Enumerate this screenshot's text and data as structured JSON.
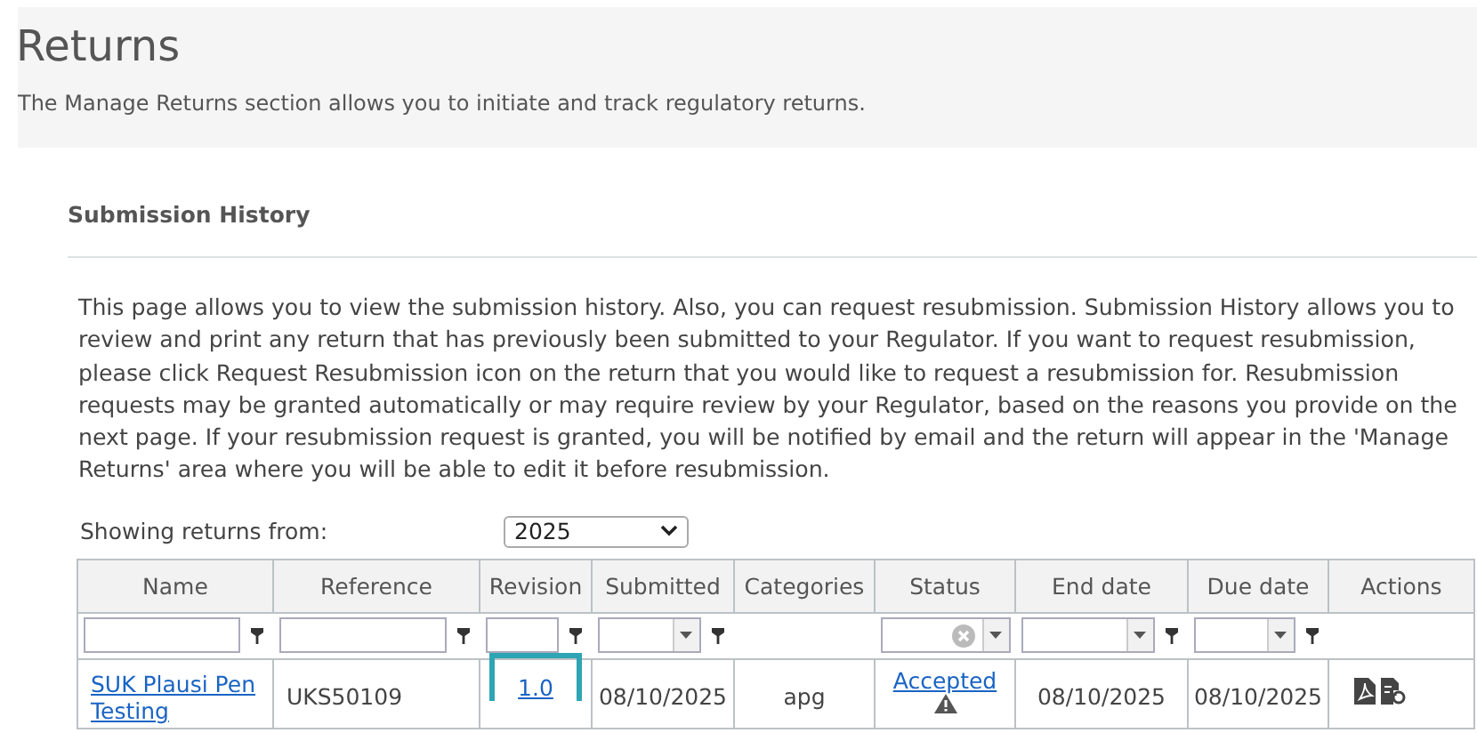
{
  "header": {
    "title": "Returns",
    "subtitle": "The Manage Returns section allows you to initiate and track regulatory returns."
  },
  "section": {
    "title": "Submission History",
    "description": "This page allows you to view the submission history. Also, you can request resubmission. Submission History allows you to review and print any return that has previously been submitted to your Regulator. If you want to request resubmission, please click Request Resubmission icon on the return that you would like to request a resubmission for. Resubmission requests may be granted automatically or may require review by your Regulator, based on the reasons you provide on the next page. If your resubmission request is granted, you will be notified by email and the return will appear in the 'Manage Returns' area where you will be able to edit it before resubmission."
  },
  "year_filter": {
    "label": "Showing returns from:",
    "value": "2025"
  },
  "table": {
    "columns": [
      {
        "label": "Name",
        "filter": {
          "kind": "text"
        }
      },
      {
        "label": "Reference",
        "filter": {
          "kind": "text"
        }
      },
      {
        "label": "Revision",
        "filter": {
          "kind": "text"
        }
      },
      {
        "label": "Submitted",
        "filter": {
          "kind": "dropdown"
        }
      },
      {
        "label": "Categories"
      },
      {
        "label": "Status",
        "filter": {
          "kind": "clearable"
        }
      },
      {
        "label": "End date",
        "filter": {
          "kind": "dropdown"
        }
      },
      {
        "label": "Due date",
        "filter": {
          "kind": "dropdown"
        }
      },
      {
        "label": "Actions"
      }
    ],
    "rows": [
      {
        "cells": [
          {
            "kind": "link",
            "text": "SUK Plausi Pen Testing",
            "highlighted": false
          },
          {
            "kind": "text",
            "text": "UKS50109",
            "highlighted": false
          },
          {
            "kind": "link",
            "text": "1.0",
            "highlighted": true
          },
          {
            "kind": "text",
            "text": "08/10/2025",
            "highlighted": false
          },
          {
            "kind": "text",
            "text": "apg",
            "highlighted": false
          },
          {
            "kind": "status",
            "text": "Accepted",
            "highlighted": false
          },
          {
            "kind": "text",
            "text": "08/10/2025",
            "highlighted": false
          },
          {
            "kind": "text",
            "text": "08/10/2025",
            "highlighted": false
          },
          {
            "kind": "actions",
            "highlighted": false
          }
        ]
      }
    ]
  }
}
